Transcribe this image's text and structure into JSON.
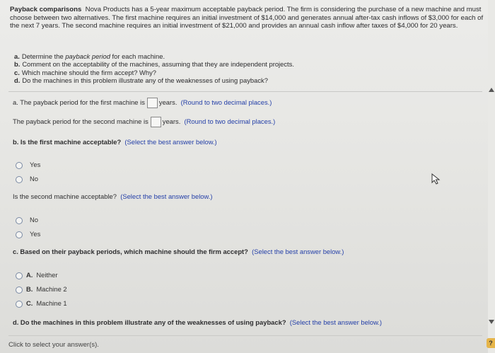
{
  "problem": {
    "title": "Payback comparisons",
    "body": "Nova Products has a 5-year maximum acceptable payback period. The firm is considering the purchase of a new machine and must choose between two alternatives. The first machine requires an initial investment of $14,000 and generates annual after-tax cash inflows of $3,000 for each of the next 7 years. The second machine requires an initial investment of $21,000 and provides an annual cash inflow after taxes of $4,000 for 20 years.",
    "parts": [
      {
        "letter": "a.",
        "pre": "Determine the ",
        "em": "payback period",
        "post": " for each machine."
      },
      {
        "letter": "b.",
        "pre": "Comment on the acceptability of the machines, assuming that they are independent projects.",
        "em": "",
        "post": ""
      },
      {
        "letter": "c.",
        "pre": "Which machine should the firm accept? Why?",
        "em": "",
        "post": ""
      },
      {
        "letter": "d.",
        "pre": "Do the machines in this problem illustrate any of the weaknesses of using payback?",
        "em": "",
        "post": ""
      }
    ]
  },
  "qa": {
    "q1_pre": "a.  The payback period for the first machine is",
    "q1_unit": "years.",
    "q1_hint": "(Round to two decimal places.)",
    "q2_pre": "The payback period for the second machine is",
    "q2_unit": "years.",
    "q2_hint": "(Round to two decimal places.)",
    "q3": "b.  Is the first machine acceptable?",
    "q3_hint": "(Select the best answer below.)",
    "q3_options": [
      "Yes",
      "No"
    ],
    "q4": "Is the second machine acceptable?",
    "q4_hint": "(Select the best answer below.)",
    "q4_options": [
      "No",
      "Yes"
    ],
    "q5": "c.  Based on their payback periods, which machine should the firm accept?",
    "q5_hint": "(Select the best answer below.)",
    "q5_options": [
      {
        "letter": "A.",
        "label": "Neither"
      },
      {
        "letter": "B.",
        "label": "Machine 2"
      },
      {
        "letter": "C.",
        "label": "Machine 1"
      }
    ],
    "q6": "d.  Do the machines in this problem illustrate any of the weaknesses of using payback?",
    "q6_hint": "(Select the best answer below.)"
  },
  "footer": {
    "text": "Click to select your answer(s)."
  },
  "help": {
    "label": "?"
  }
}
